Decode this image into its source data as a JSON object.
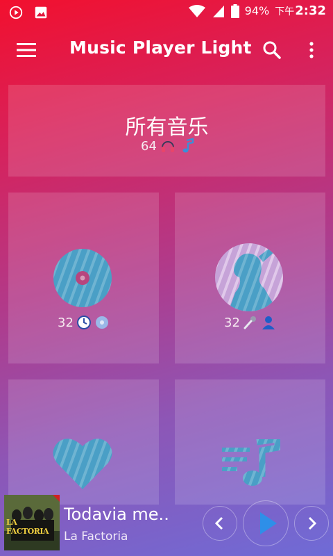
{
  "status_bar": {
    "battery": "94%",
    "time_prefix": "下午",
    "time": "2:32"
  },
  "app_bar": {
    "title": "Music Player Light"
  },
  "all_music": {
    "label": "所有音乐",
    "count": "64"
  },
  "albums": {
    "count": "32"
  },
  "artists": {
    "count": "32"
  },
  "now_playing": {
    "title": "Todavia me..",
    "artist": "La Factoria",
    "album_art_text": "LA FACTORIA"
  },
  "colors": {
    "accent_blue": "#4aa3e0",
    "background_top": "#f2102e",
    "background_bottom": "#6f6bd6"
  }
}
